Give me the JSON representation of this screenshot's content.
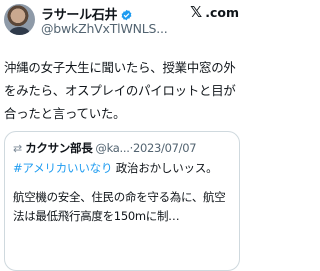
{
  "author": {
    "display_name": "ラサール石井",
    "handle": "@bwkZhVxTlWNLS...",
    "avatar_icon": "person-avatar",
    "verified_icon": "verified-badge-icon",
    "verified_color": "#1d9bf0"
  },
  "brand": {
    "logo_mark": "𝕏",
    "logo_text": ".com"
  },
  "tweet": {
    "text": "沖縄の女子大生に聞いたら、授業中窓の外をみたら、オスプレイのパイロットと目が合ったと言っていた。"
  },
  "quote": {
    "avatar_icon": "repost-avatar-icon",
    "avatar_glyph": "⇄",
    "display_name": "カクサン部長",
    "meta": "@ka...·2023/07/07",
    "hashtag": "#アメリカいいなり",
    "line1_rest": " 政治おかしいッス。",
    "body": "航空機の安全、住民の命を守る為に、航空法は最低飛行高度を150mに制…",
    "hashtag_color": "#1d9bf0"
  }
}
